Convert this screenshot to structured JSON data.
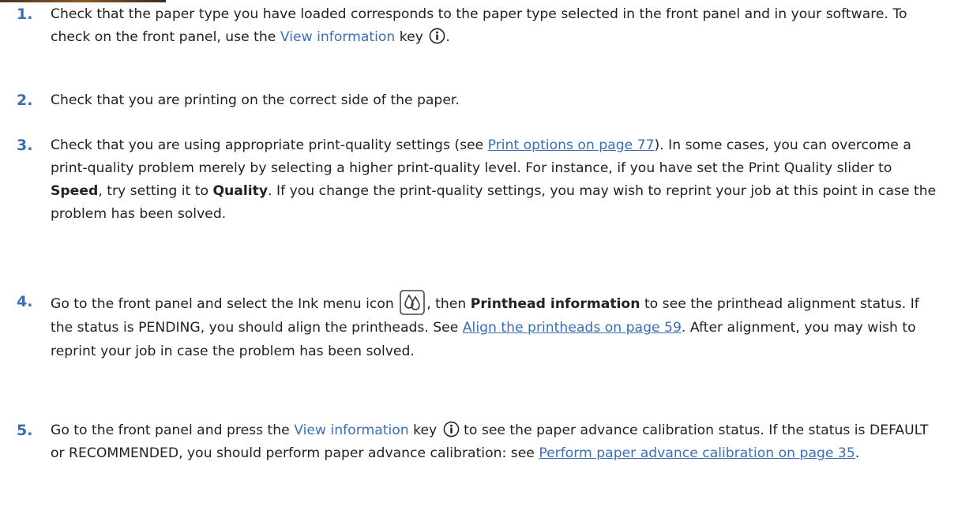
{
  "steps": [
    {
      "number": "1.",
      "part1": "Check that the paper type you have loaded corresponds to the paper type selected in the front panel and in your software. To check on the front panel, use the ",
      "ui_term": "View information",
      "part2": " key",
      "part3": ".",
      "icon": "info-circle-icon"
    },
    {
      "number": "2.",
      "text": "Check that you are printing on the correct side of the paper."
    },
    {
      "number": "3.",
      "part1": "Check that you are using appropriate print-quality settings (see ",
      "link": "Print options on page 77",
      "part2": "). In some cases, you can overcome a print-quality problem merely by selecting a higher print-quality level. For instance, if you have set the Print Quality slider to ",
      "bold1": "Speed",
      "part3": ", try setting it to ",
      "bold2": "Quality",
      "part4": ". If you change the print-quality settings, you may wish to reprint your job at this point in case the problem has been solved."
    },
    {
      "number": "4.",
      "part1": "Go to the front panel and select the Ink menu icon",
      "part2": ", then ",
      "bold1": "Printhead information",
      "part3": " to see the printhead alignment status. If the status is PENDING, you should align the printheads. See ",
      "link": "Align the printheads on page 59",
      "part4": ". After alignment, you may wish to reprint your job in case the problem has been solved.",
      "icon": "ink-drops-icon"
    },
    {
      "number": "5.",
      "part1": "Go to the front panel and press the ",
      "ui_term": "View information",
      "part2": " key",
      "part3": " to see the paper advance calibration status. If the status is DEFAULT or RECOMMENDED, you should perform paper advance calibration: see ",
      "link": "Perform paper advance calibration on page 35",
      "part4": ".",
      "icon": "info-circle-icon"
    }
  ],
  "colors": {
    "accent": "#3a6fb6",
    "text": "#222222"
  }
}
